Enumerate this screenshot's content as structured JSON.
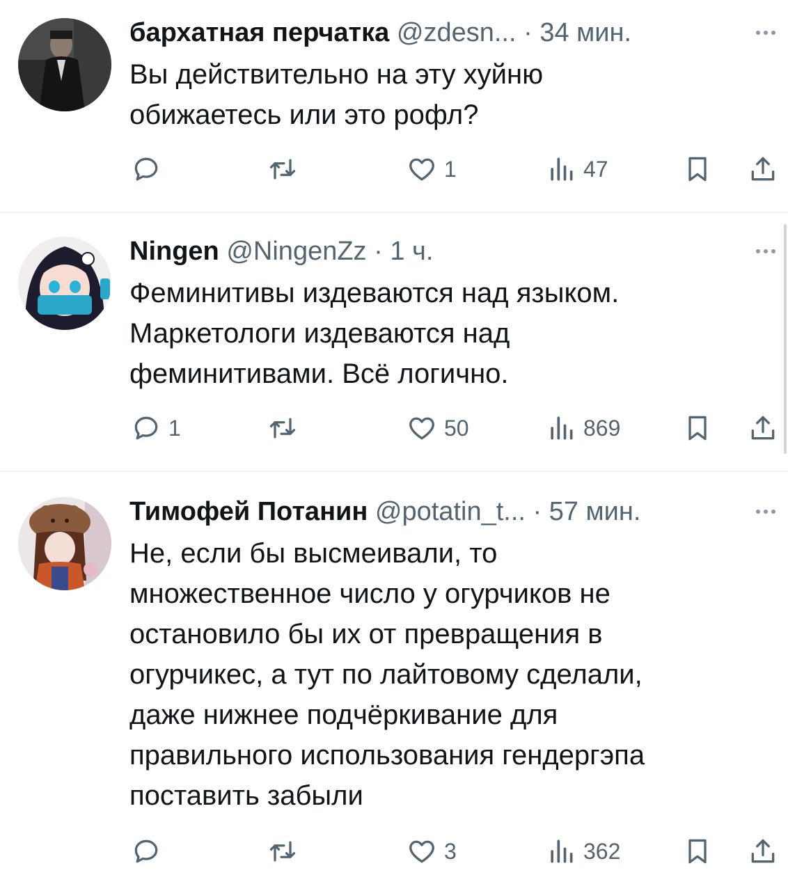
{
  "tweets": [
    {
      "name": "бархатная перчатка",
      "handle": "@zdesn...",
      "time": "· 34 мин.",
      "lines": [
        "Вы действительно на эту хуйню",
        "обижаетесь или это рофл?"
      ],
      "replies": "",
      "retweets": "",
      "likes": "1",
      "views": "47"
    },
    {
      "name": "Ningen",
      "handle": "@NingenZz",
      "time": "· 1 ч.",
      "lines": [
        "Феминитивы издеваются над языком.",
        "Маркетологи издеваются над",
        "феминитивами. Всё логично."
      ],
      "replies": "1",
      "retweets": "",
      "likes": "50",
      "views": "869"
    },
    {
      "name": "Тимофей Потанин",
      "handle": "@potatin_t...",
      "time": "· 57 мин.",
      "lines": [
        "Не, если бы высмеивали, то",
        "множественное число у огурчиков не",
        "остановило бы их от превращения в",
        "огурчикес, а тут по лайтовому сделали,",
        "даже нижнее подчёркивание для",
        "правильного использования гендергэпа",
        "поставить забыли"
      ],
      "replies": "",
      "retweets": "",
      "likes": "3",
      "views": "362"
    }
  ],
  "icons": {
    "reply": "reply-icon",
    "retweet": "retweet-icon",
    "like": "heart-icon",
    "views": "views-icon",
    "bookmark": "bookmark-icon",
    "share": "share-icon",
    "more": "more-icon"
  },
  "colors": {
    "text": "#0f1419",
    "secondary": "#536471",
    "divider": "#eff3f4"
  }
}
